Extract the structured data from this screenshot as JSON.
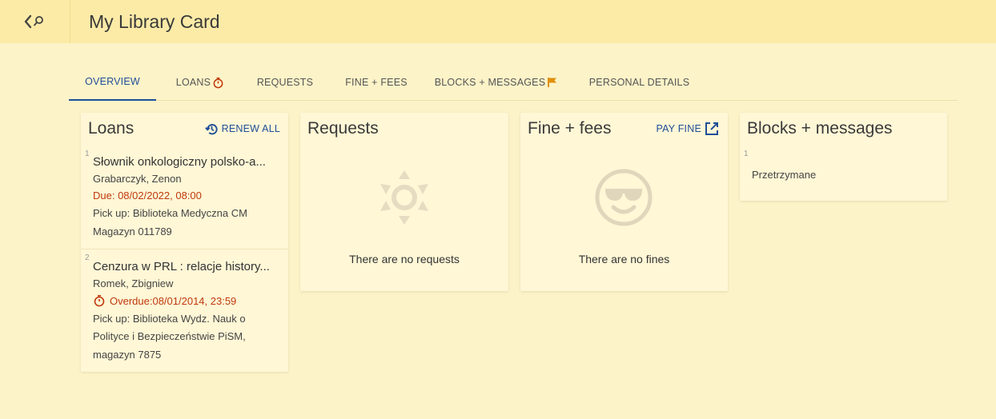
{
  "header": {
    "title": "My Library Card"
  },
  "tabs": [
    {
      "label": "OVERVIEW",
      "active": true
    },
    {
      "label": "LOANS",
      "icon": "timer-icon"
    },
    {
      "label": "REQUESTS"
    },
    {
      "label": "FINE + FEES"
    },
    {
      "label": "BLOCKS + MESSAGES",
      "icon": "flag-icon"
    },
    {
      "label": "PERSONAL DETAILS"
    }
  ],
  "loans": {
    "title": "Loans",
    "action_label": "RENEW ALL",
    "items": [
      {
        "num": "1",
        "title": "Słownik onkologiczny polsko-a...",
        "author": "Grabarczyk, Zenon",
        "due": "Due: 08/02/2022, 08:00",
        "pickup_1": "Pick up: Biblioteka Medyczna CM",
        "pickup_2": "Magazyn 011789"
      },
      {
        "num": "2",
        "title": "Cenzura w PRL : relacje history...",
        "author": "Romek, Zbigniew",
        "due": "Overdue:08/01/2014, 23:59",
        "pickup_1": "Pick up: Biblioteka Wydz. Nauk o",
        "pickup_2": "Polityce i Bezpieczeństwie PiSM,",
        "pickup_3": "magazyn 7875"
      }
    ]
  },
  "requests": {
    "title": "Requests",
    "empty_text": "There are no requests"
  },
  "fines": {
    "title": "Fine + fees",
    "action_label": "PAY FINE",
    "empty_text": "There are no fines"
  },
  "blocks": {
    "title": "Blocks + messages",
    "items": [
      {
        "num": "1",
        "text": "Przetrzymane"
      }
    ]
  },
  "colors": {
    "accent": "#1f4e99",
    "due": "#c0390c",
    "flag": "#e0900c",
    "topbar": "#fceba7",
    "background": "#fdf3c8"
  }
}
